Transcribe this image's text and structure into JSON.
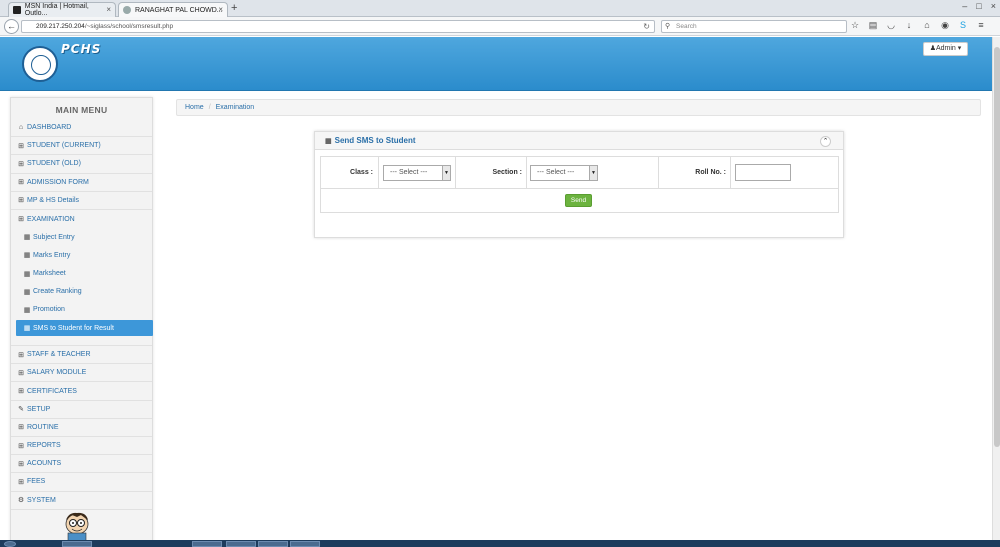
{
  "browser": {
    "tabs": [
      {
        "label": "MSN India | Hotmail, Outlo...",
        "active": false
      },
      {
        "label": "RANAGHAT PAL CHOWD...",
        "active": true
      }
    ],
    "new_tab": "+",
    "url_host": "209.217.250.204",
    "url_path": "/~siglass/school/smsresult.php",
    "search_placeholder": "Search",
    "window_controls": [
      "–",
      "□",
      "×"
    ]
  },
  "header": {
    "brand": "PCHS",
    "admin_label": "Admin",
    "colors": {
      "header": "#3a9ad9",
      "accent": "#2a6fa8",
      "send": "#6cb33f"
    }
  },
  "sidebar": {
    "title": "MAIN MENU",
    "items": [
      {
        "label": "DASHBOARD",
        "icon": "home-icon"
      },
      {
        "label": "STUDENT (CURRENT)",
        "icon": "grid-icon"
      },
      {
        "label": "STUDENT (OLD)",
        "icon": "grid-icon"
      },
      {
        "label": "ADMISSION FORM",
        "icon": "grid-icon"
      },
      {
        "label": "MP & HS Details",
        "icon": "grid-icon"
      },
      {
        "label": "EXAMINATION",
        "icon": "grid-icon"
      }
    ],
    "sub_items": [
      {
        "label": "Subject Entry"
      },
      {
        "label": "Marks Entry"
      },
      {
        "label": "Marksheet"
      },
      {
        "label": "Create Ranking"
      },
      {
        "label": "Promotion"
      },
      {
        "label": "SMS to Student for Result",
        "active": true
      }
    ],
    "items_after": [
      {
        "label": "STAFF & TEACHER",
        "icon": "grid-icon"
      },
      {
        "label": "SALARY MODULE",
        "icon": "grid-icon"
      },
      {
        "label": "CERTIFICATES",
        "icon": "grid-icon"
      },
      {
        "label": "SETUP",
        "icon": "wrench-icon"
      },
      {
        "label": "ROUTINE",
        "icon": "grid-icon"
      },
      {
        "label": "REPORTS",
        "icon": "grid-icon"
      },
      {
        "label": "ACOUNTS",
        "icon": "grid-icon"
      },
      {
        "label": "FEES",
        "icon": "grid-icon"
      },
      {
        "label": "SYSTEM",
        "icon": "gears-icon"
      }
    ]
  },
  "breadcrumb": {
    "home": "Home",
    "separator": "/",
    "current": "Examination"
  },
  "panel": {
    "title": "Send SMS to Student",
    "class_label": "Class :",
    "class_value": "--- Select ---",
    "section_label": "Section :",
    "section_value": "--- Select ---",
    "roll_label": "Roll No. :",
    "roll_value": "",
    "send_label": "Send"
  }
}
